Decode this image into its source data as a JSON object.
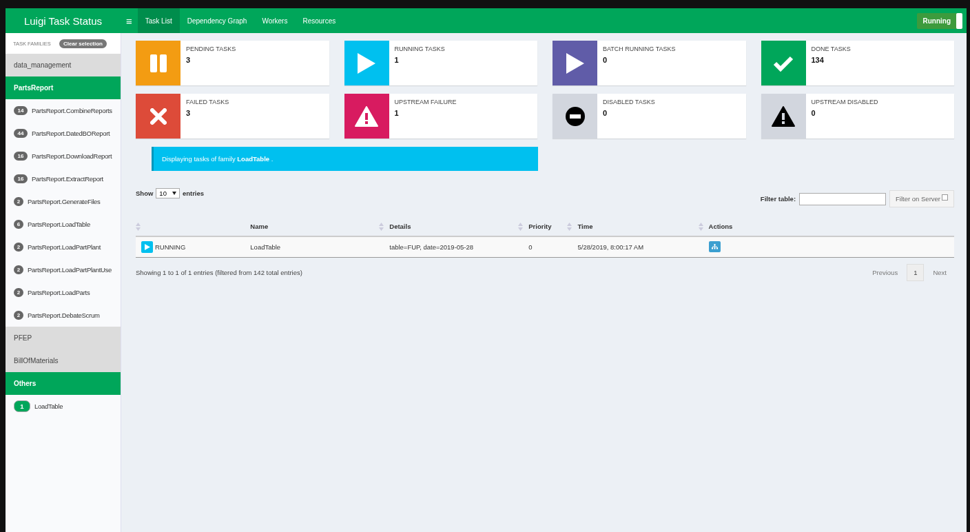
{
  "header": {
    "title": "Luigi Task Status",
    "menu_icon": "≡",
    "nav": [
      {
        "label": "Task List",
        "selected": true
      },
      {
        "label": "Dependency Graph",
        "selected": false
      },
      {
        "label": "Workers",
        "selected": false
      },
      {
        "label": "Resources",
        "selected": false
      }
    ],
    "status_button": {
      "label": "Running",
      "on": true
    }
  },
  "sidebar": {
    "heading": "TASK FAMILIES",
    "clear_button": "Clear selection",
    "groups": [
      {
        "label": "data_management",
        "expanded": false
      },
      {
        "label": "PartsReport",
        "expanded": true,
        "children": [
          {
            "count": "14",
            "label": "PartsReport.CombineReports",
            "selected": false
          },
          {
            "count": "44",
            "label": "PartsReport.DatedBOReport",
            "selected": false
          },
          {
            "count": "16",
            "label": "PartsReport.DownloadReport",
            "selected": false
          },
          {
            "count": "16",
            "label": "PartsReport.ExtractReport",
            "selected": false
          },
          {
            "count": "2",
            "label": "PartsReport.GenerateFiles",
            "selected": false
          },
          {
            "count": "6",
            "label": "PartsReport.LoadTable",
            "selected": false
          },
          {
            "count": "2",
            "label": "PartsReport.LoadPartPlant",
            "selected": false
          },
          {
            "count": "2",
            "label": "PartsReport.LoadPartPlantUse",
            "selected": false
          },
          {
            "count": "2",
            "label": "PartsReport.LoadParts",
            "selected": false
          },
          {
            "count": "2",
            "label": "PartsReport.DebateScrum",
            "selected": false
          }
        ]
      },
      {
        "label": "PFEP",
        "expanded": false
      },
      {
        "label": "BillOfMaterials",
        "expanded": false
      },
      {
        "label": "Others",
        "expanded": true,
        "children": [
          {
            "count": "1",
            "label": "LoadTable",
            "selected": true
          }
        ]
      }
    ]
  },
  "stats": [
    {
      "kind": "pause",
      "color": "#f39c12",
      "label": "PENDING TASKS",
      "value": "3"
    },
    {
      "kind": "play",
      "color": "#00c0ef",
      "label": "RUNNING TASKS",
      "value": "1"
    },
    {
      "kind": "play",
      "color": "#605ca8",
      "label": "BATCH RUNNING TASKS",
      "value": "0"
    },
    {
      "kind": "check",
      "color": "#00a65a",
      "label": "DONE TASKS",
      "value": "134"
    },
    {
      "kind": "cross",
      "color": "#dd4b39",
      "label": "FAILED TASKS",
      "value": "3"
    },
    {
      "kind": "warning",
      "color": "#d81b60",
      "label": "UPSTREAM FAILURE",
      "value": "1"
    },
    {
      "kind": "minus",
      "color": "#d2d6de",
      "label": "DISABLED TASKS",
      "value": "0"
    },
    {
      "kind": "warning-dark",
      "color": "#d2d6de",
      "label": "UPSTREAM DISABLED",
      "value": "0"
    }
  ],
  "info": "Displaying tasks of family **LoadTable** .",
  "table_controls": {
    "show_label": "Show",
    "page_size": "10",
    "entries_label": "entries",
    "filter_label": "Filter table:",
    "filter_server_button": "Filter on Server",
    "filter_server_checked": false
  },
  "table": {
    "columns": [
      {
        "sortable": true
      },
      {
        "label": "Name",
        "sortable": true
      },
      {
        "label": "Details",
        "sortable": true
      },
      {
        "label": "Priority",
        "sortable": true
      },
      {
        "label": "Time",
        "sortable": true
      },
      {
        "label": "Actions",
        "sortable": false
      }
    ],
    "rows": [
      {
        "status": "RUNNING",
        "name": "LoadTable",
        "details": "table=FUP, date=2019-05-28",
        "priority": "0",
        "time": "5/28/2019, 8:00:17 AM"
      }
    ]
  },
  "footer": {
    "summary": "Showing 1 to 1 of 1 entries (filtered from 142 total entries)",
    "pages": [
      {
        "label": "Previous",
        "kind": "prev",
        "selected": false
      },
      {
        "label": "1",
        "kind": "page",
        "selected": true
      },
      {
        "label": "Next",
        "kind": "next",
        "selected": false
      }
    ]
  }
}
